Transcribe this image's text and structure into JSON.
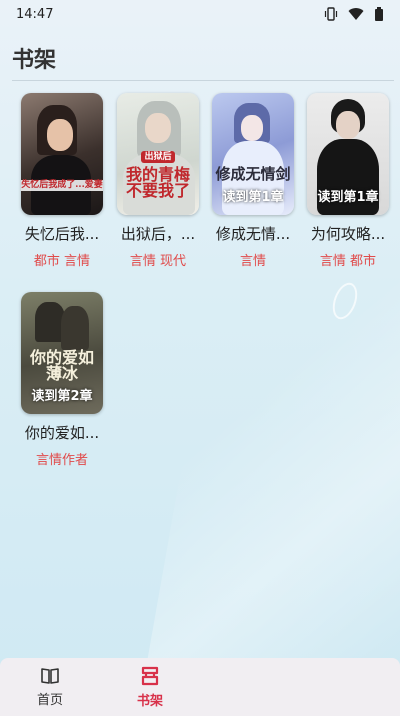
{
  "status_bar": {
    "time": "14:47"
  },
  "page": {
    "title": "书架"
  },
  "books": [
    {
      "title": "失忆后我...",
      "tags": "都市 言情",
      "cover_text": "失忆后我成了...爱妻",
      "progress": ""
    },
    {
      "title": "出狱后，...",
      "tags": "言情 现代",
      "cover_text": "我的青梅不要我了",
      "cover_small": "出狱后",
      "progress": ""
    },
    {
      "title": "修成无情...",
      "tags": "言情",
      "cover_text": "修成无情剑",
      "progress": "读到第1章"
    },
    {
      "title": "为何攻略...",
      "tags": "言情 都市",
      "cover_text": "",
      "progress": "读到第1章"
    },
    {
      "title": "你的爱如...",
      "tags": "言情作者",
      "cover_text": "你的爱如薄冰",
      "progress": "读到第2章"
    }
  ],
  "tabs": [
    {
      "label": "首页",
      "active": false
    },
    {
      "label": "书架",
      "active": true
    }
  ],
  "colors": {
    "accent": "#d8314a",
    "tag": "#e04a4a"
  }
}
